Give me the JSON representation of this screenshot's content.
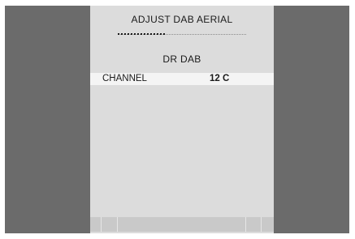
{
  "menu": {
    "title": "ADJUST  DAB  AERIAL",
    "signal_level": 0.37,
    "station_name": "DR  DAB",
    "rows": [
      {
        "label": "CHANNEL",
        "value": "12 C"
      }
    ]
  }
}
